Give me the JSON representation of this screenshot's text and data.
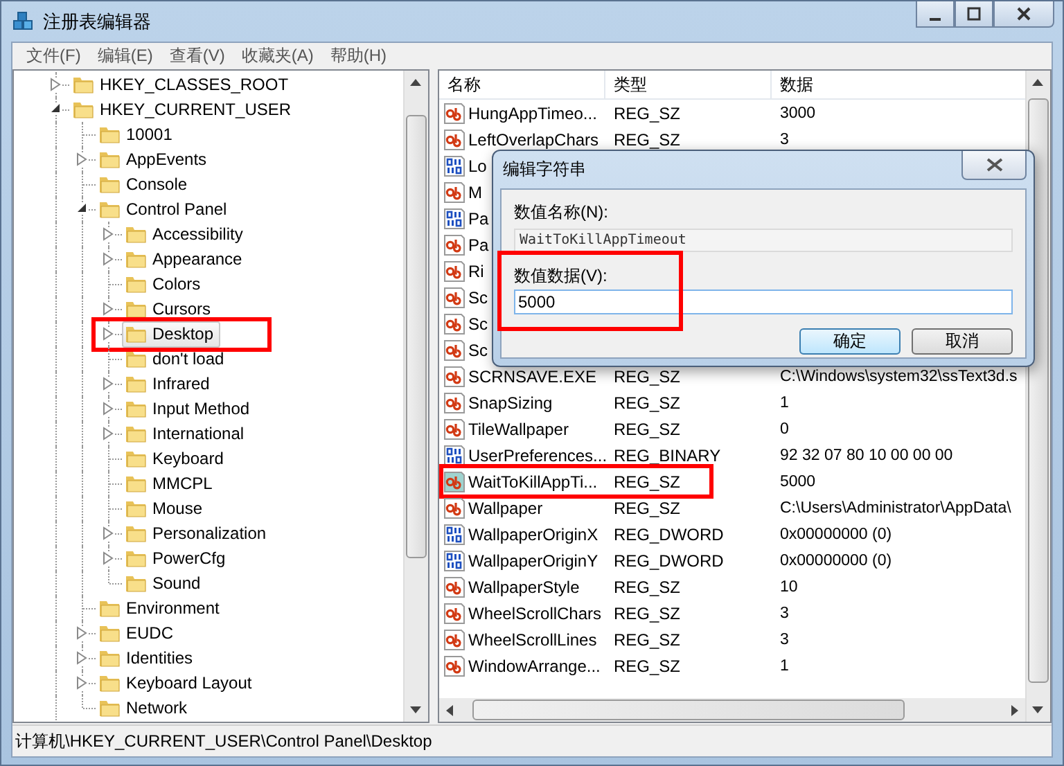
{
  "window": {
    "title": "注册表编辑器"
  },
  "menu": [
    "文件(F)",
    "编辑(E)",
    "查看(V)",
    "收藏夹(A)",
    "帮助(H)"
  ],
  "tree": [
    {
      "label": "HKEY_CLASSES_ROOT",
      "has_children": true,
      "expanded": false,
      "selected": false,
      "highlighted": false
    },
    {
      "label": "HKEY_CURRENT_USER",
      "has_children": true,
      "expanded": true,
      "selected": false,
      "highlighted": false,
      "children": [
        {
          "label": "10001",
          "has_children": false,
          "selected": false,
          "highlighted": false
        },
        {
          "label": "AppEvents",
          "has_children": true,
          "expanded": false,
          "selected": false,
          "highlighted": false
        },
        {
          "label": "Console",
          "has_children": false,
          "selected": false,
          "highlighted": false
        },
        {
          "label": "Control Panel",
          "has_children": true,
          "expanded": true,
          "selected": false,
          "highlighted": false,
          "children": [
            {
              "label": "Accessibility",
              "has_children": true,
              "expanded": false,
              "selected": false,
              "highlighted": false
            },
            {
              "label": "Appearance",
              "has_children": true,
              "expanded": false,
              "selected": false,
              "highlighted": false
            },
            {
              "label": "Colors",
              "has_children": false,
              "selected": false,
              "highlighted": false
            },
            {
              "label": "Cursors",
              "has_children": true,
              "expanded": false,
              "selected": false,
              "highlighted": false
            },
            {
              "label": "Desktop",
              "has_children": true,
              "expanded": false,
              "selected": true,
              "highlighted": true
            },
            {
              "label": "don't load",
              "has_children": false,
              "selected": false,
              "highlighted": false
            },
            {
              "label": "Infrared",
              "has_children": true,
              "expanded": false,
              "selected": false,
              "highlighted": false
            },
            {
              "label": "Input Method",
              "has_children": true,
              "expanded": false,
              "selected": false,
              "highlighted": false
            },
            {
              "label": "International",
              "has_children": true,
              "expanded": false,
              "selected": false,
              "highlighted": false
            },
            {
              "label": "Keyboard",
              "has_children": false,
              "selected": false,
              "highlighted": false
            },
            {
              "label": "MMCPL",
              "has_children": false,
              "selected": false,
              "highlighted": false
            },
            {
              "label": "Mouse",
              "has_children": false,
              "selected": false,
              "highlighted": false
            },
            {
              "label": "Personalization",
              "has_children": true,
              "expanded": false,
              "selected": false,
              "highlighted": false
            },
            {
              "label": "PowerCfg",
              "has_children": true,
              "expanded": false,
              "selected": false,
              "highlighted": false
            },
            {
              "label": "Sound",
              "has_children": false,
              "selected": false,
              "highlighted": false
            }
          ]
        },
        {
          "label": "Environment",
          "has_children": false,
          "selected": false,
          "highlighted": false
        },
        {
          "label": "EUDC",
          "has_children": true,
          "expanded": false,
          "selected": false,
          "highlighted": false
        },
        {
          "label": "Identities",
          "has_children": true,
          "expanded": false,
          "selected": false,
          "highlighted": false
        },
        {
          "label": "Keyboard Layout",
          "has_children": true,
          "expanded": false,
          "selected": false,
          "highlighted": false
        },
        {
          "label": "Network",
          "has_children": false,
          "selected": false,
          "highlighted": false
        }
      ]
    }
  ],
  "columns": [
    "名称",
    "类型",
    "数据"
  ],
  "rows": [
    {
      "kind": "string",
      "name": "HungAppTimeo...",
      "type": "REG_SZ",
      "data": "3000",
      "selected": false,
      "highlighted": false
    },
    {
      "kind": "string",
      "name": "LeftOverlapChars",
      "type": "REG_SZ",
      "data": "3",
      "selected": false,
      "highlighted": false
    },
    {
      "kind": "binary",
      "name": "Lo",
      "selected": false,
      "highlighted": false
    },
    {
      "kind": "string",
      "name": "M",
      "selected": false,
      "highlighted": false
    },
    {
      "kind": "binary",
      "name": "Pa",
      "selected": false,
      "highlighted": false
    },
    {
      "kind": "string",
      "name": "Pa",
      "selected": false,
      "highlighted": false
    },
    {
      "kind": "string",
      "name": "Ri",
      "selected": false,
      "highlighted": false
    },
    {
      "kind": "string",
      "name": "Sc",
      "selected": false,
      "highlighted": false
    },
    {
      "kind": "string",
      "name": "Sc",
      "selected": false,
      "highlighted": false
    },
    {
      "kind": "string",
      "name": "Sc",
      "selected": false,
      "highlighted": false
    },
    {
      "kind": "string",
      "name": "SCRNSAVE.EXE",
      "type": "REG_SZ",
      "data": "C:\\Windows\\system32\\ssText3d.s",
      "selected": false,
      "highlighted": false
    },
    {
      "kind": "string",
      "name": "SnapSizing",
      "type": "REG_SZ",
      "data": "1",
      "selected": false,
      "highlighted": false
    },
    {
      "kind": "string",
      "name": "TileWallpaper",
      "type": "REG_SZ",
      "data": "0",
      "selected": false,
      "highlighted": false
    },
    {
      "kind": "binary",
      "name": "UserPreferences...",
      "type": "REG_BINARY",
      "data": "92 32 07 80 10 00 00 00",
      "selected": false,
      "highlighted": false
    },
    {
      "kind": "string",
      "name": "WaitToKillAppTi...",
      "type": "REG_SZ",
      "data": "5000",
      "selected": true,
      "highlighted": true
    },
    {
      "kind": "string",
      "name": "Wallpaper",
      "type": "REG_SZ",
      "data": "C:\\Users\\Administrator\\AppData\\",
      "selected": false,
      "highlighted": false
    },
    {
      "kind": "binary",
      "name": "WallpaperOriginX",
      "type": "REG_DWORD",
      "data": "0x00000000 (0)",
      "selected": false,
      "highlighted": false
    },
    {
      "kind": "binary",
      "name": "WallpaperOriginY",
      "type": "REG_DWORD",
      "data": "0x00000000 (0)",
      "selected": false,
      "highlighted": false
    },
    {
      "kind": "string",
      "name": "WallpaperStyle",
      "type": "REG_SZ",
      "data": "10",
      "selected": false,
      "highlighted": false
    },
    {
      "kind": "string",
      "name": "WheelScrollChars",
      "type": "REG_SZ",
      "data": "3",
      "selected": false,
      "highlighted": false
    },
    {
      "kind": "string",
      "name": "WheelScrollLines",
      "type": "REG_SZ",
      "data": "3",
      "selected": false,
      "highlighted": false
    },
    {
      "kind": "string",
      "name": "WindowArrange...",
      "type": "REG_SZ",
      "data": "1",
      "selected": false,
      "highlighted": false
    }
  ],
  "dialog": {
    "title": "编辑字符串",
    "name_label": "数值名称(N):",
    "name_value": "WaitToKillAppTimeout",
    "data_label": "数值数据(V):",
    "data_value": "5000",
    "data_highlighted": true,
    "buttons": [
      {
        "label": "确定",
        "default": true
      },
      {
        "label": "取消",
        "default": false
      }
    ]
  },
  "status_bar": "计算机\\HKEY_CURRENT_USER\\Control Panel\\Desktop"
}
